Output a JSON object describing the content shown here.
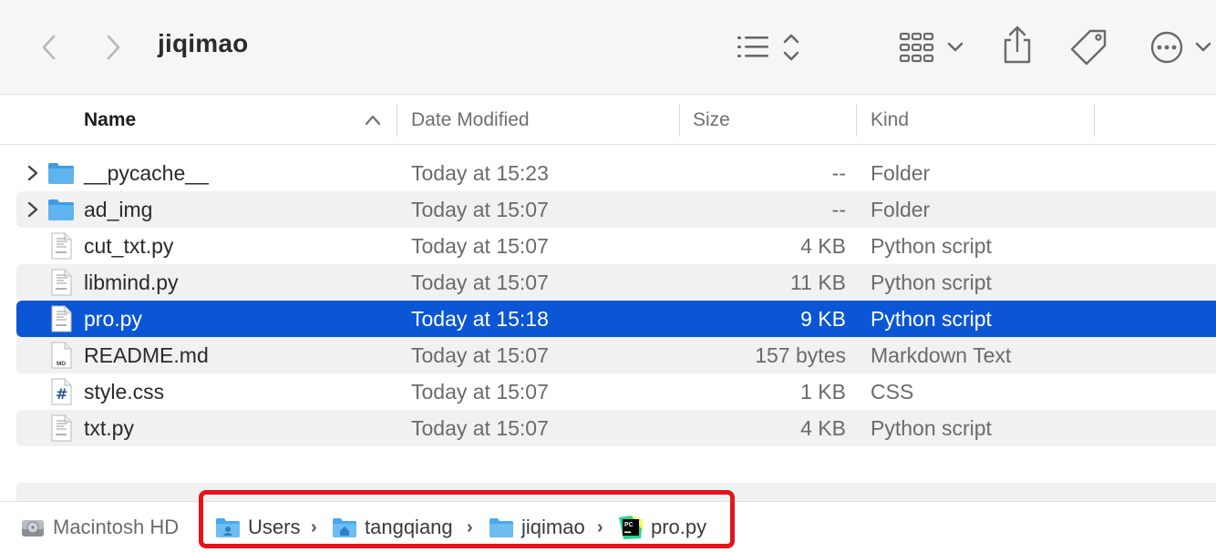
{
  "window": {
    "title": "jiqimao"
  },
  "toolbar": {
    "back_icon": "chevron-left-icon",
    "forward_icon": "chevron-right-icon",
    "view_icon": "list-view-icon",
    "group_icon": "icon-grid-icon",
    "share_icon": "share-icon",
    "tag_icon": "tag-icon",
    "more_icon": "ellipsis-circle-icon"
  },
  "columns": {
    "name": "Name",
    "date_modified": "Date Modified",
    "size": "Size",
    "kind": "Kind"
  },
  "files": [
    {
      "name": "__pycache__",
      "modified": "Today at 15:23",
      "size": "--",
      "kind": "Folder",
      "icon": "folder-icon"
    },
    {
      "name": "ad_img",
      "modified": "Today at 15:07",
      "size": "--",
      "kind": "Folder",
      "icon": "folder-icon"
    },
    {
      "name": "cut_txt.py",
      "modified": "Today at 15:07",
      "size": "4 KB",
      "kind": "Python script",
      "icon": "python-file-icon"
    },
    {
      "name": "libmind.py",
      "modified": "Today at 15:07",
      "size": "11 KB",
      "kind": "Python script",
      "icon": "python-file-icon"
    },
    {
      "name": "pro.py",
      "modified": "Today at 15:18",
      "size": "9 KB",
      "kind": "Python script",
      "icon": "python-file-icon",
      "selected": true
    },
    {
      "name": "README.md",
      "modified": "Today at 15:07",
      "size": "157 bytes",
      "kind": "Markdown Text",
      "icon": "markdown-file-icon",
      "badge": "MD"
    },
    {
      "name": "style.css",
      "modified": "Today at 15:07",
      "size": "1 KB",
      "kind": "CSS",
      "icon": "css-file-icon",
      "badge": "#"
    },
    {
      "name": "txt.py",
      "modified": "Today at 15:07",
      "size": "4 KB",
      "kind": "Python script",
      "icon": "python-file-icon"
    }
  ],
  "pathbar": {
    "items": [
      {
        "label": "Macintosh HD",
        "icon": "hard-drive-icon"
      },
      {
        "label": "Users",
        "icon": "users-folder-icon"
      },
      {
        "label": "tangqiang",
        "icon": "home-folder-icon"
      },
      {
        "label": "jiqimao",
        "icon": "folder-icon"
      },
      {
        "label": "pro.py",
        "icon": "pycharm-icon",
        "badge": "PC"
      }
    ],
    "separator": "›"
  },
  "colors": {
    "selection": "#0a56d4",
    "highlight_box": "#e5141b",
    "folder_blue": "#4aa8ec"
  }
}
